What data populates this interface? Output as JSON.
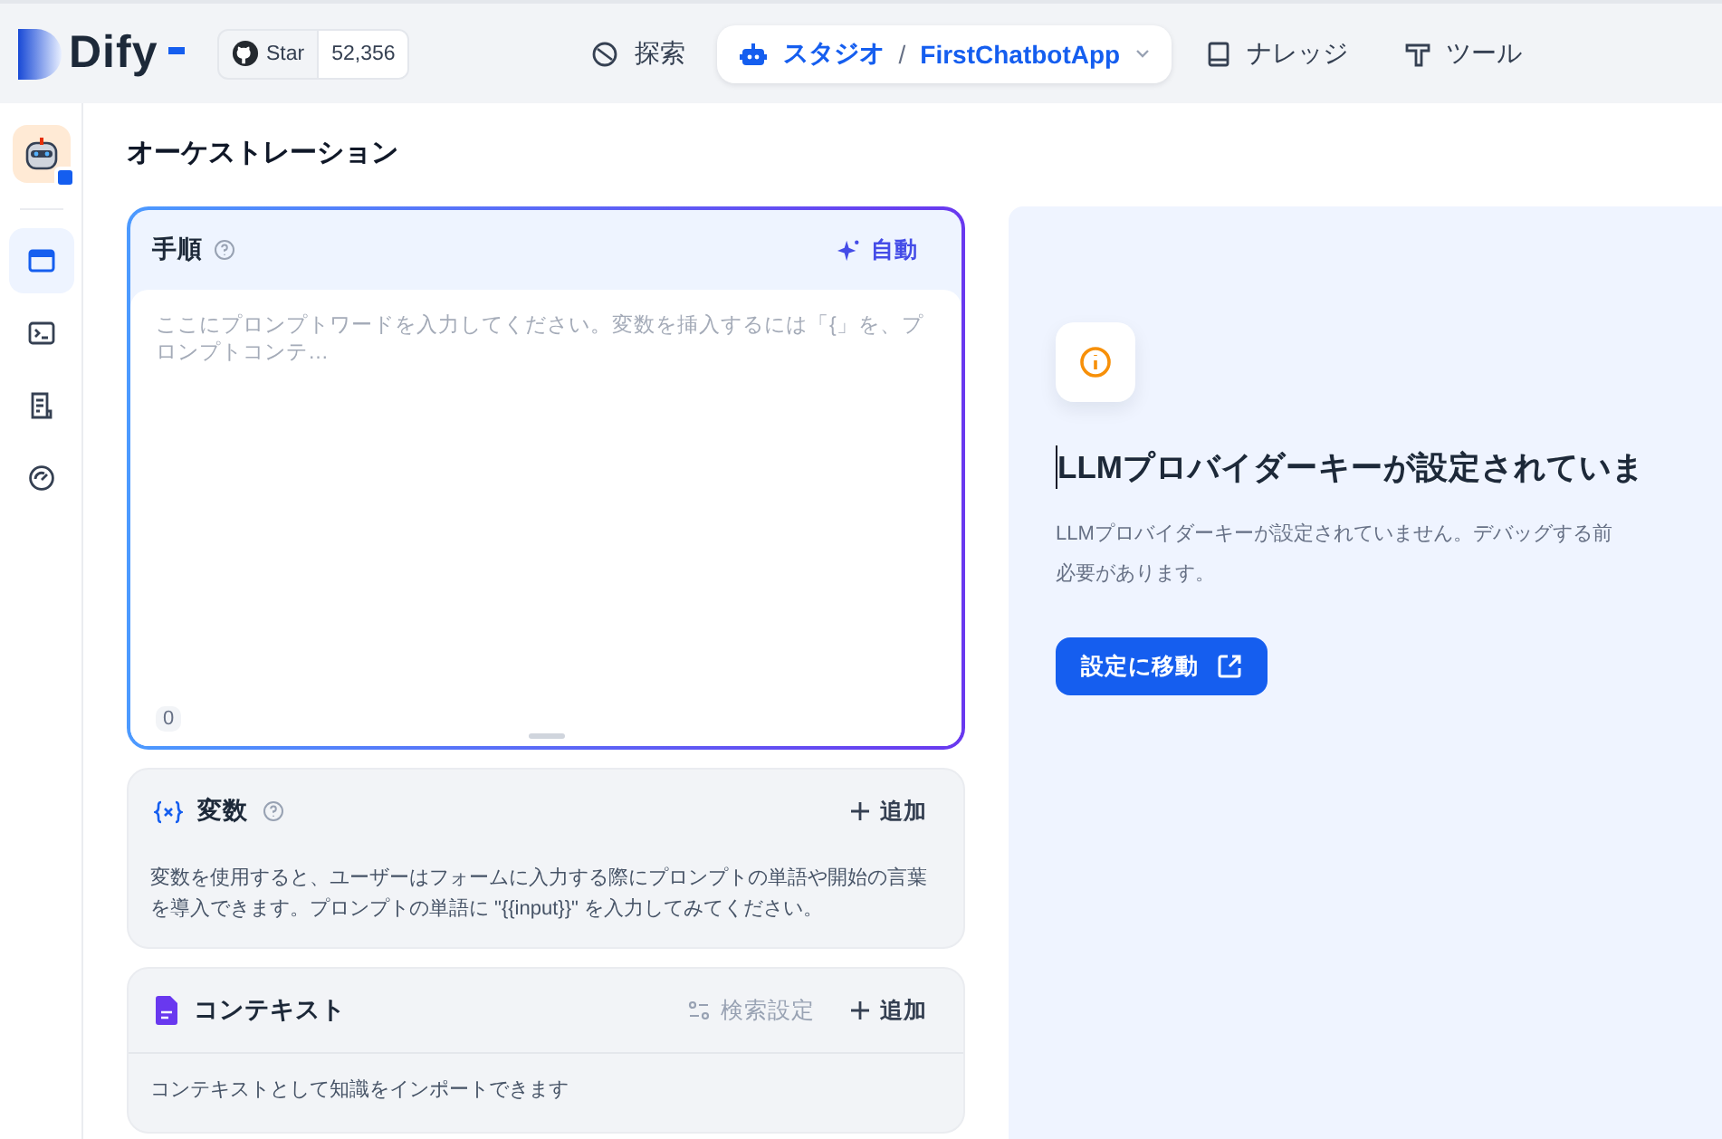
{
  "header": {
    "logo": "Dify",
    "github": {
      "label": "Star",
      "count": "52,356"
    },
    "nav": [
      {
        "kind": "explore",
        "label": "探索",
        "selected": false
      },
      {
        "kind": "studio",
        "label": "スタジオ",
        "selected": true,
        "separator": "/",
        "app": "FirstChatbotApp"
      },
      {
        "kind": "knowledge",
        "label": "ナレッジ",
        "selected": false
      },
      {
        "kind": "tools",
        "label": "ツール",
        "selected": false
      }
    ]
  },
  "sidebar": {
    "items": [
      {
        "kind": "orchestrate",
        "selected": true
      },
      {
        "kind": "api",
        "selected": false
      },
      {
        "kind": "logs",
        "selected": false
      },
      {
        "kind": "monitor",
        "selected": false
      }
    ]
  },
  "page_title": "オーケストレーション",
  "instructions": {
    "title": "手順",
    "auto_button": "自動",
    "placeholder": "ここにプロンプトワードを入力してください。変数を挿入するには「{」を、プロンプトコンテ…",
    "counter": "0"
  },
  "variables": {
    "title": "変数",
    "add_button": "追加",
    "description": "変数を使用すると、ユーザーはフォームに入力する際にプロンプトの単語や開始の言葉を導入できます。プロンプトの単語に \"{{input}}\" を入力してみてください。"
  },
  "context": {
    "title": "コンテキスト",
    "retrieval_button": "検索設定",
    "add_button": "追加",
    "description": "コンテキストとして知識をインポートできます"
  },
  "debug": {
    "title": "LLMプロバイダーキーが設定されていま",
    "description_lines": [
      "LLMプロバイダーキーが設定されていません。デバッグする前",
      "必要があります。"
    ],
    "button": "設定に移動"
  }
}
